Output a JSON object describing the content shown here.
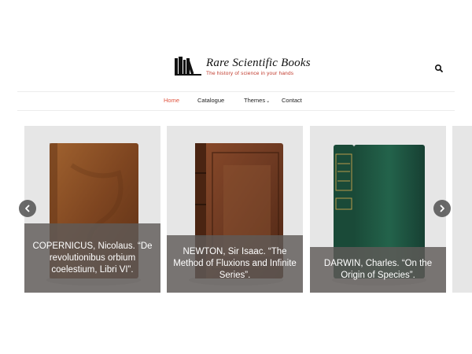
{
  "site": {
    "title": "Rare Scientific Books",
    "tagline": "The history of science in your hands"
  },
  "nav": {
    "items": [
      {
        "label": "Home",
        "active": true
      },
      {
        "label": "Catalogue"
      },
      {
        "label": "Themes",
        "has_dropdown": true
      },
      {
        "label": "Contact"
      }
    ]
  },
  "carousel": {
    "slides": [
      {
        "caption": "COPERNICUS, Nicolaus. “De revolutionibus orbium coelestium, Libri VI”.",
        "cover_color": "#8b4f26"
      },
      {
        "caption": "NEWTON, Sir Isaac. “The Method of Fluxions and Infinite Series”.",
        "cover_color": "#6e3a22"
      },
      {
        "caption": "DARWIN, Charles. “On the Origin of Species”.",
        "cover_color": "#1f5a45"
      }
    ]
  },
  "colors": {
    "accent": "#e0533e",
    "caption_overlay": "#5f5a58",
    "slide_background": "#e6e6e6"
  },
  "icons": {
    "search": "search-icon",
    "prev": "chevron-left-icon",
    "next": "chevron-right-icon",
    "logo": "books-icon"
  }
}
